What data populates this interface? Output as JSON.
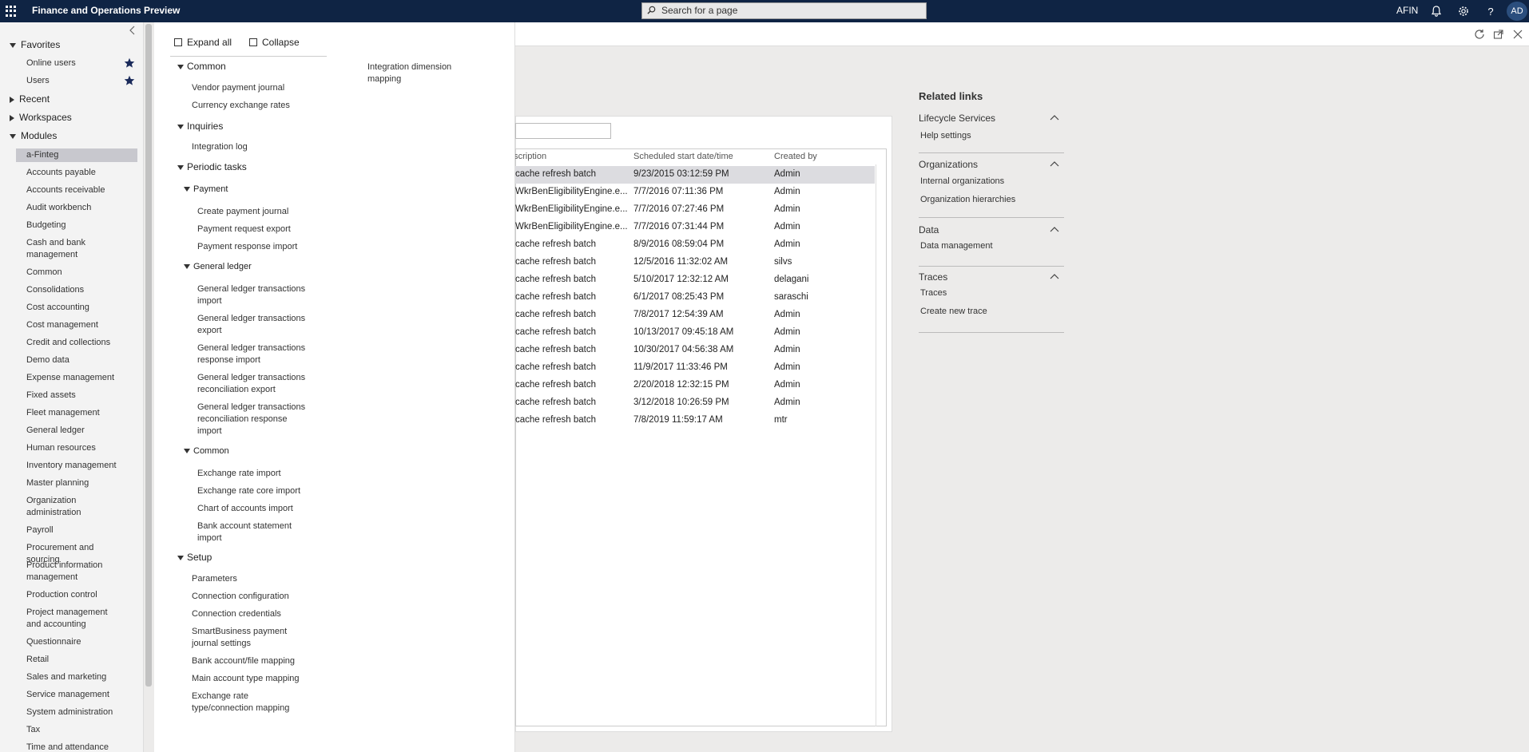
{
  "topbar": {
    "app_title": "Finance and Operations Preview",
    "search_placeholder": "Search for a page",
    "company": "AFIN",
    "avatar_initials": "AD"
  },
  "nav": {
    "favorites_label": "Favorites",
    "favorites": [
      {
        "label": "Online users"
      },
      {
        "label": "Users"
      }
    ],
    "recent_label": "Recent",
    "workspaces_label": "Workspaces",
    "modules_label": "Modules",
    "modules": [
      "a-Finteg",
      "Accounts payable",
      "Accounts receivable",
      "Audit workbench",
      "Budgeting",
      "Cash and bank management",
      "Common",
      "Consolidations",
      "Cost accounting",
      "Cost management",
      "Credit and collections",
      "Demo data",
      "Expense management",
      "Fixed assets",
      "Fleet management",
      "General ledger",
      "Human resources",
      "Inventory management",
      "Master planning",
      "Organization administration",
      "Payroll",
      "Procurement and sourcing",
      "Product information management",
      "Production control",
      "Project management and accounting",
      "Questionnaire",
      "Retail",
      "Sales and marketing",
      "Service management",
      "System administration",
      "Tax",
      "Time and attendance"
    ]
  },
  "flyout": {
    "expand_all": "Expand all",
    "collapse": "Collapse",
    "common_heading": "Common",
    "common_links": [
      "Vendor payment journal",
      "Currency exchange rates"
    ],
    "inquiries_heading": "Inquiries",
    "inquiries_links": [
      "Integration log"
    ],
    "periodic_heading": "Periodic tasks",
    "payment_heading": "Payment",
    "payment_links": [
      "Create payment journal",
      "Payment request export",
      "Payment response import"
    ],
    "gl_heading": "General ledger",
    "gl_links": [
      "General ledger transactions import",
      "General ledger transactions export",
      "General ledger transactions response import",
      "General ledger transactions reconciliation export",
      "General ledger transactions reconciliation response import"
    ],
    "common2_heading": "Common",
    "common2_links": [
      "Exchange rate import",
      "Exchange rate core import",
      "Chart of accounts import",
      "Bank account statement import"
    ],
    "setup_heading": "Setup",
    "setup_links": [
      "Parameters",
      "Connection configuration",
      "Connection credentials",
      "SmartBusiness payment journal settings",
      "Bank account/file mapping",
      "Main account type mapping",
      "Exchange rate type/connection mapping"
    ],
    "right_column_links": [
      "Integration dimension mapping"
    ]
  },
  "grid": {
    "columns": [
      "escription",
      "Scheduled start date/time",
      "Created by"
    ],
    "rows": [
      {
        "desc": "cache refresh batch",
        "date": "9/23/2015 03:12:59 PM",
        "by": "Admin"
      },
      {
        "desc": "WkrBenEligibilityEngine.e...",
        "date": "7/7/2016 07:11:36 PM",
        "by": "Admin"
      },
      {
        "desc": "WkrBenEligibilityEngine.e...",
        "date": "7/7/2016 07:27:46 PM",
        "by": "Admin"
      },
      {
        "desc": "WkrBenEligibilityEngine.e...",
        "date": "7/7/2016 07:31:44 PM",
        "by": "Admin"
      },
      {
        "desc": "cache refresh batch",
        "date": "8/9/2016 08:59:04 PM",
        "by": "Admin"
      },
      {
        "desc": "cache refresh batch",
        "date": "12/5/2016 11:32:02 AM",
        "by": "silvs"
      },
      {
        "desc": "cache refresh batch",
        "date": "5/10/2017 12:32:12 AM",
        "by": "delagani"
      },
      {
        "desc": "cache refresh batch",
        "date": "6/1/2017 08:25:43 PM",
        "by": "saraschi"
      },
      {
        "desc": "cache refresh batch",
        "date": "7/8/2017 12:54:39 AM",
        "by": "Admin"
      },
      {
        "desc": "cache refresh batch",
        "date": "10/13/2017 09:45:18 AM",
        "by": "Admin"
      },
      {
        "desc": "cache refresh batch",
        "date": "10/30/2017 04:56:38 AM",
        "by": "Admin"
      },
      {
        "desc": "cache refresh batch",
        "date": "11/9/2017 11:33:46 PM",
        "by": "Admin"
      },
      {
        "desc": "cache refresh batch",
        "date": "2/20/2018 12:32:15 PM",
        "by": "Admin"
      },
      {
        "desc": "cache refresh batch",
        "date": "3/12/2018 10:26:59 PM",
        "by": "Admin"
      },
      {
        "desc": "cache refresh batch",
        "date": "7/8/2019 11:59:17 AM",
        "by": "mtr"
      }
    ]
  },
  "related": {
    "title": "Related links",
    "sections": [
      {
        "title": "Lifecycle Services",
        "links": [
          "Help settings"
        ]
      },
      {
        "title": "Organizations",
        "links": [
          "Internal organizations",
          "Organization hierarchies"
        ]
      },
      {
        "title": "Data",
        "links": [
          "Data management"
        ]
      },
      {
        "title": "Traces",
        "links": [
          "Traces",
          "Create new trace"
        ]
      }
    ]
  }
}
